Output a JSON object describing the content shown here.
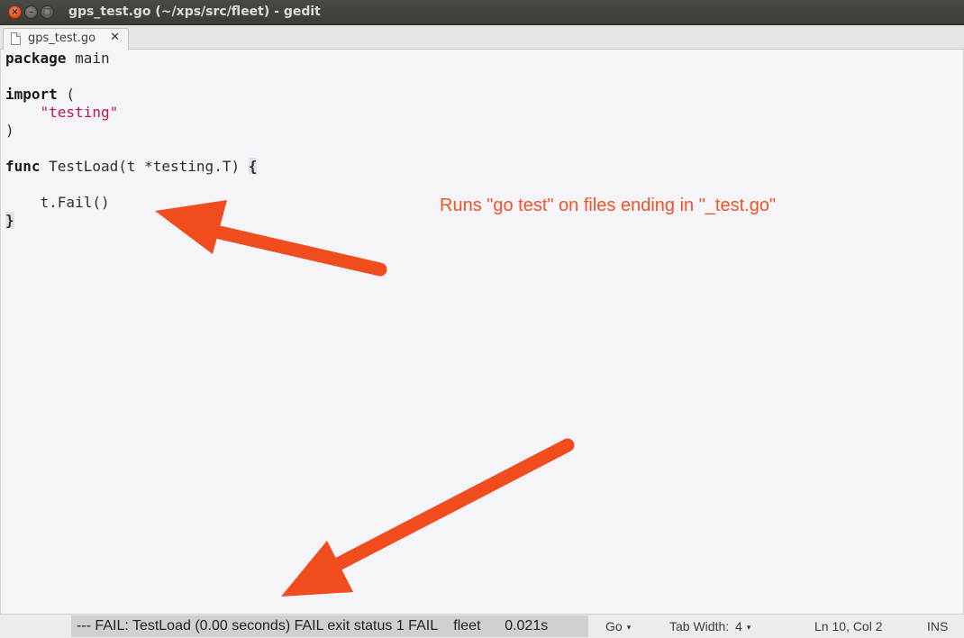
{
  "window": {
    "title": "gps_test.go (~/xps/src/fleet) - gedit",
    "close_glyph": "×",
    "minimize_glyph": "–",
    "maximize_glyph": "□"
  },
  "tab": {
    "label": "gps_test.go",
    "close_glyph": "✕",
    "icon": "document-icon"
  },
  "code": {
    "lines": [
      [
        {
          "t": "package",
          "c": "kw"
        },
        {
          "t": " main"
        }
      ],
      [],
      [
        {
          "t": "import",
          "c": "kw"
        },
        {
          "t": " ("
        }
      ],
      [
        {
          "t": "    "
        },
        {
          "t": "\"testing\"",
          "c": "str"
        }
      ],
      [
        {
          "t": ")"
        }
      ],
      [],
      [
        {
          "t": "func",
          "c": "kw"
        },
        {
          "t": " TestLoad(t *testing.T) "
        },
        {
          "t": "{",
          "c": "brace"
        }
      ],
      [],
      [
        {
          "t": "    t.Fail()"
        }
      ],
      [
        {
          "t": "}",
          "c": "brace"
        }
      ]
    ]
  },
  "annotation": {
    "text": "Runs \"go test\" on files ending in \"_test.go\"",
    "color": "#f05225"
  },
  "statusbar": {
    "message": "--- FAIL: TestLoad (0.00 seconds) FAIL exit status 1 FAIL    fleet      0.021s",
    "language": "Go",
    "tab_width_label": "Tab Width:",
    "tab_width_value": "4",
    "position": "Ln 10, Col 2",
    "mode": "INS",
    "caret_glyph": "▾"
  }
}
